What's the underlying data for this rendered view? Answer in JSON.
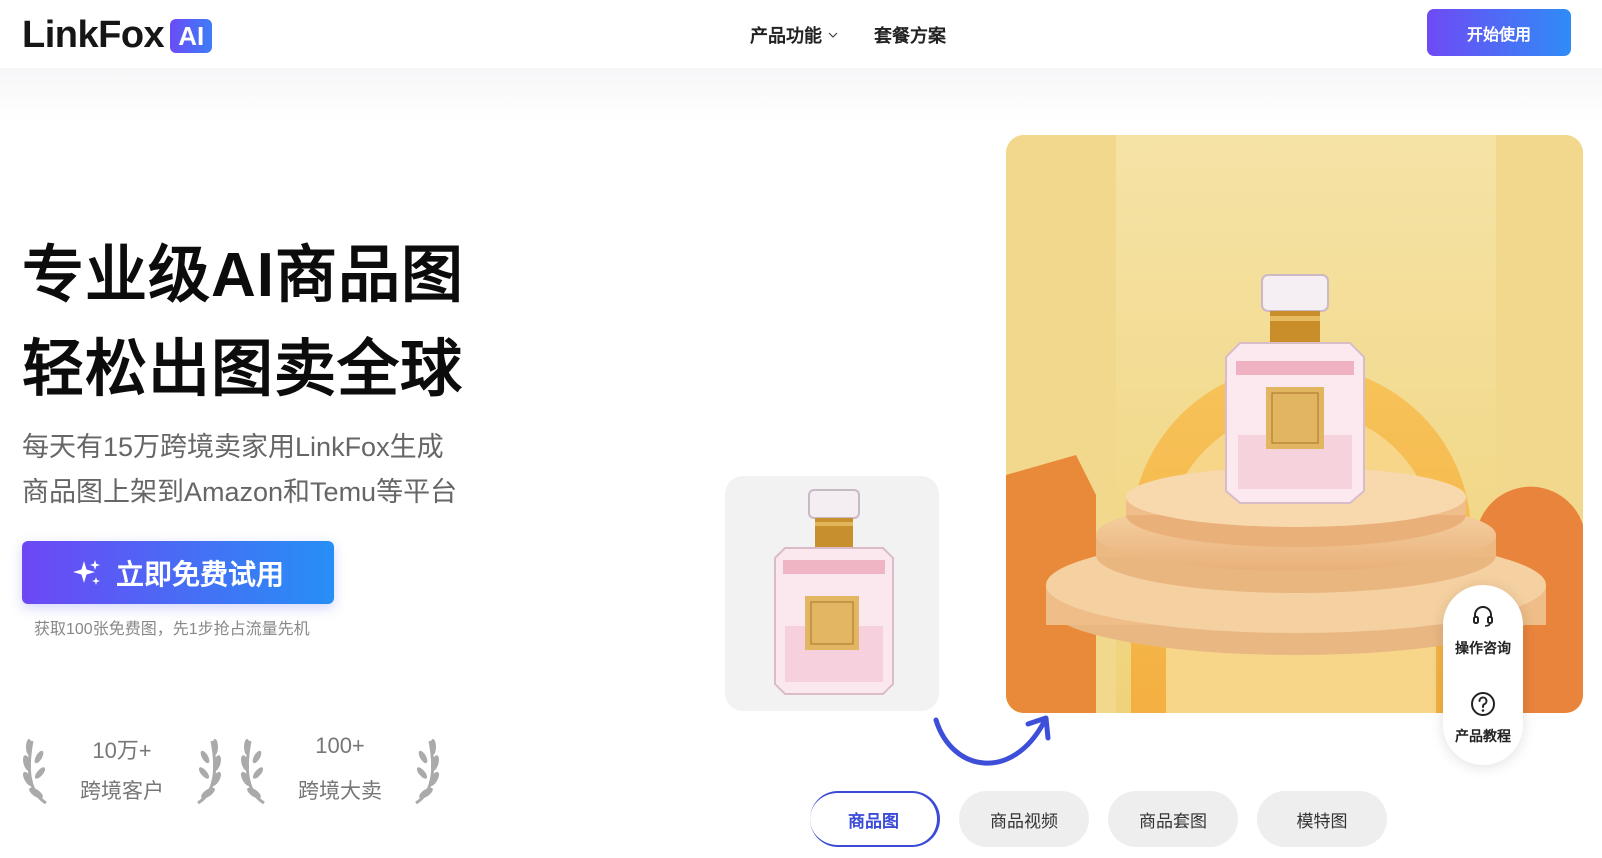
{
  "header": {
    "logo_text": "LinkFox",
    "logo_badge": "AI",
    "nav": [
      {
        "label": "产品功能",
        "has_dropdown": true
      },
      {
        "label": "套餐方案",
        "has_dropdown": false
      }
    ],
    "start_button": "开始使用"
  },
  "hero": {
    "title_line1": "专业级AI商品图",
    "title_line2": "轻松出图卖全球",
    "subtitle_line1": "每天有15万跨境卖家用LinkFox生成",
    "subtitle_line2": "商品图上架到Amazon和Temu等平台",
    "cta_label": "立即免费试用",
    "cta_note": "获取100张免费图，先1步抢占流量先机",
    "stats": [
      {
        "value": "10万+",
        "label": "跨境客户"
      },
      {
        "value": "100+",
        "label": "跨境大卖"
      }
    ]
  },
  "showcase": {
    "tabs": [
      {
        "label": "商品图",
        "active": true
      },
      {
        "label": "商品视频",
        "active": false
      },
      {
        "label": "商品套图",
        "active": false
      },
      {
        "label": "模特图",
        "active": false
      }
    ]
  },
  "help_widget": {
    "items": [
      {
        "label": "操作咨询",
        "icon": "headset-icon"
      },
      {
        "label": "产品教程",
        "icon": "question-icon"
      }
    ]
  },
  "colors": {
    "accent_start": "#6d47f5",
    "accent_end": "#268ff5",
    "active_tab": "#3a4bd8"
  }
}
